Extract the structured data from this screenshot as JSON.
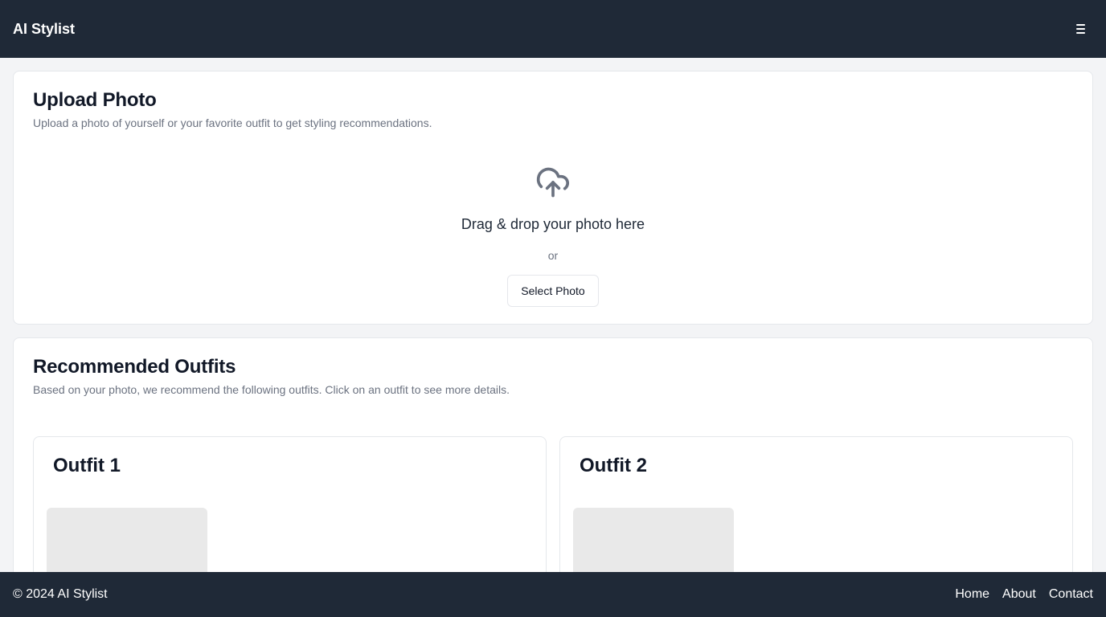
{
  "header": {
    "title": "AI Stylist",
    "menu_icon": "hamburger-menu-icon"
  },
  "upload": {
    "title": "Upload Photo",
    "subtitle": "Upload a photo of yourself or your favorite outfit to get styling recommendations.",
    "icon": "cloud-upload-icon",
    "drop_text": "Drag & drop your photo here",
    "or_text": "or",
    "button_label": "Select Photo"
  },
  "recommendations": {
    "title": "Recommended Outfits",
    "subtitle": "Based on your photo, we recommend the following outfits. Click on an outfit to see more details.",
    "outfits": [
      {
        "title": "Outfit 1"
      },
      {
        "title": "Outfit 2"
      }
    ]
  },
  "footer": {
    "copyright": "© 2024 AI Stylist",
    "links": [
      "Home",
      "About",
      "Contact"
    ]
  },
  "colors": {
    "header_bg": "#1f2937",
    "page_bg": "#f3f4f6",
    "muted_text": "#6b7280",
    "icon_gray": "#6b7280",
    "placeholder_bg": "#e9e9e9"
  }
}
